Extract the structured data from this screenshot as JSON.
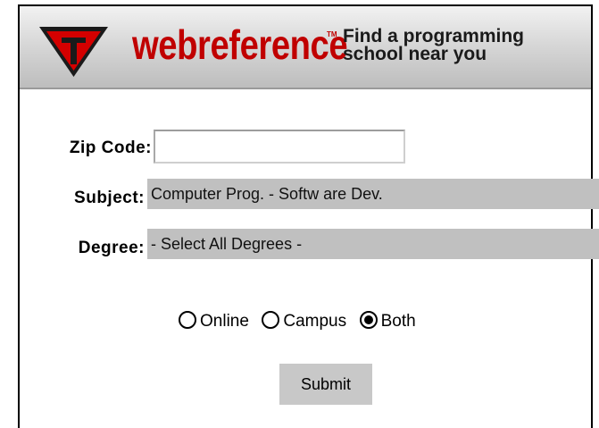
{
  "header": {
    "brand": "webreference",
    "trademark": "TM",
    "tagline_line1": "Find a programming",
    "tagline_line2": "school near you",
    "logo_icon": "red-inverted-triangle-logo-icon",
    "brand_color": "#c00000"
  },
  "form": {
    "zip_label": "Zip Code:",
    "zip_value": "",
    "subject_label": "Subject:",
    "subject_value": "Computer Prog. - Softw are Dev.",
    "degree_label": "Degree:",
    "degree_value": "- Select All Degrees -",
    "radios": [
      {
        "label": "Online",
        "checked": false
      },
      {
        "label": "Campus",
        "checked": false
      },
      {
        "label": "Both",
        "checked": true
      }
    ],
    "submit_label": "Submit"
  }
}
